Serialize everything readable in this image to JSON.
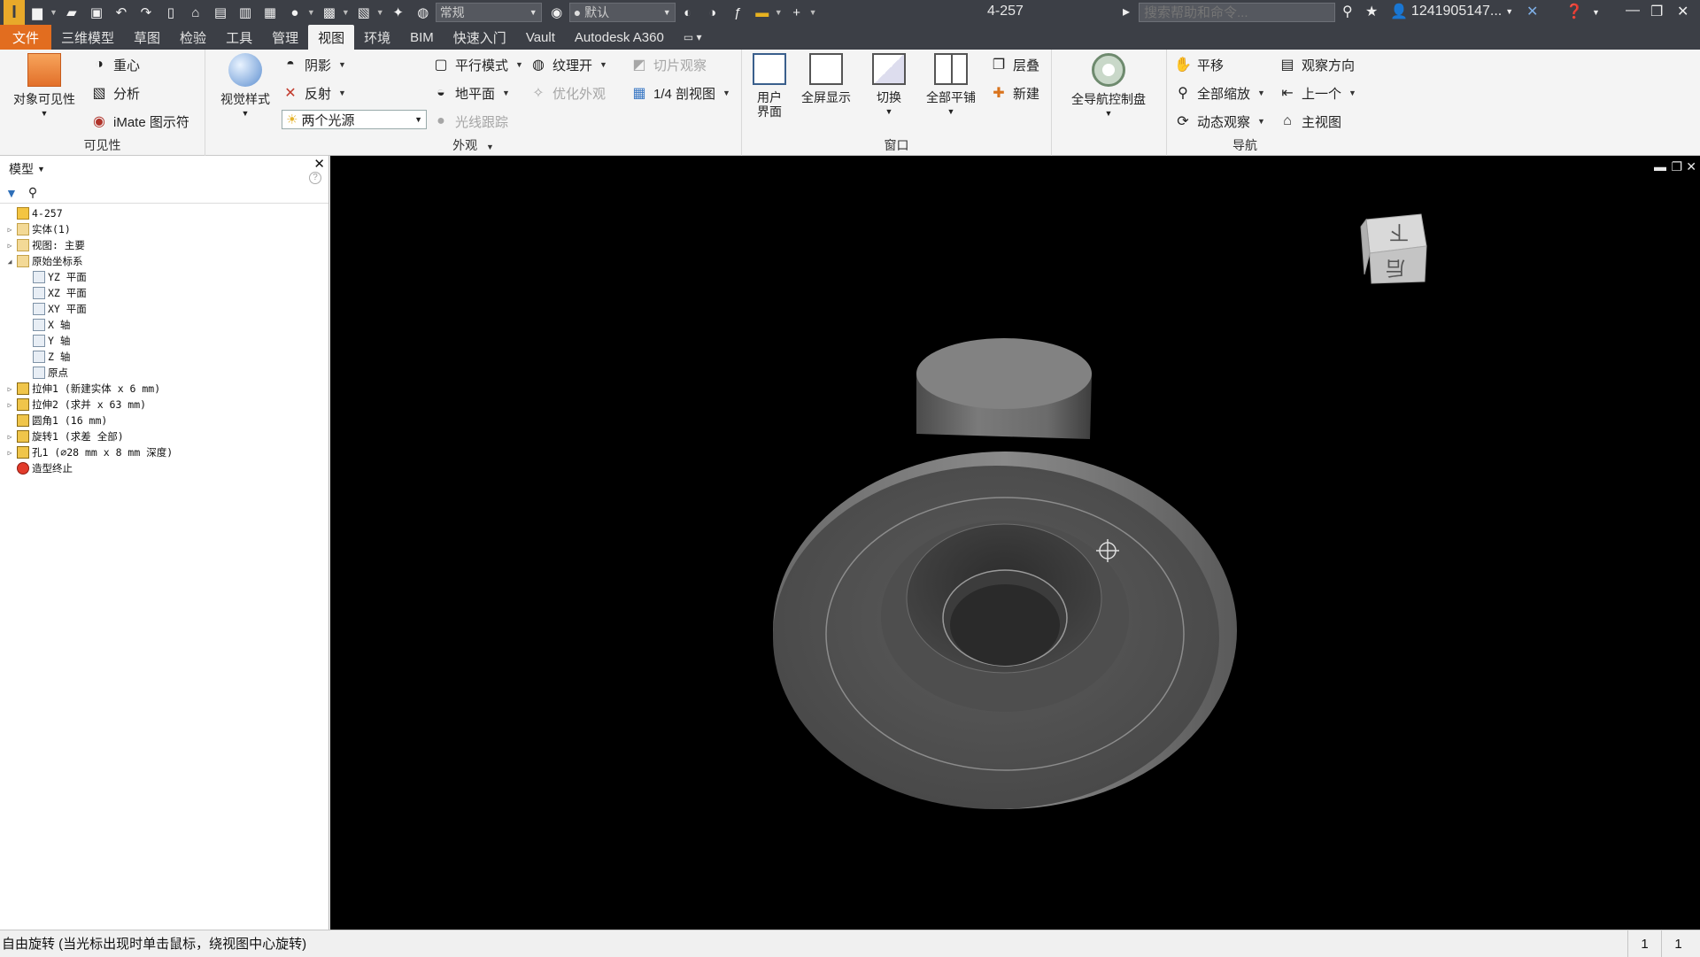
{
  "window": {
    "doc_title": "4-257",
    "search_placeholder": "搜索帮助和命令...",
    "user": "1241905147...",
    "appearance_combo": "常规",
    "material_combo": "默认"
  },
  "tabs": [
    {
      "label": "文件"
    },
    {
      "label": "三维模型"
    },
    {
      "label": "草图"
    },
    {
      "label": "检验"
    },
    {
      "label": "工具"
    },
    {
      "label": "管理"
    },
    {
      "label": "视图"
    },
    {
      "label": "环境"
    },
    {
      "label": "BIM"
    },
    {
      "label": "快速入门"
    },
    {
      "label": "Vault"
    },
    {
      "label": "Autodesk A360"
    }
  ],
  "ribbon": {
    "visibility": {
      "title": "可见性",
      "object_visibility": "对象可见性",
      "center_of_gravity": "重心",
      "analysis": "分析",
      "imate_glyph": "iMate 图示符"
    },
    "appearance": {
      "title": "外观",
      "visual_style": "视觉样式",
      "shadows": "阴影",
      "reflections": "反射",
      "lighting": "两个光源",
      "parallel_mode": "平行模式",
      "ground_plane": "地平面",
      "texture_on": "纹理开",
      "optimize_appearance": "优化外观",
      "ray_tracing": "光线跟踪",
      "slice_graphics": "切片观察",
      "quarter_section": "1/4 剖视图"
    },
    "windows": {
      "title": "窗口",
      "user_interface_1": "用户",
      "user_interface_2": "界面",
      "full_screen": "全屏显示",
      "switch": "切换",
      "tile_all": "全部平铺",
      "cascade": "层叠",
      "new": "新建"
    },
    "steering": {
      "full_navigation_wheel": "全导航控制盘"
    },
    "navigate": {
      "title": "导航",
      "pan": "平移",
      "zoom_all": "全部缩放",
      "orbit": "动态观察",
      "look_at": "观察方向",
      "previous": "上一个",
      "home_view": "主视图"
    }
  },
  "browser": {
    "title": "模型",
    "tree": [
      {
        "label": "4-257",
        "icon": "part-icon",
        "indent": 0,
        "expander": ""
      },
      {
        "label": "实体(1)",
        "icon": "folder-icon",
        "indent": 0,
        "expander": "▷"
      },
      {
        "label": "视图: 主要",
        "icon": "view-icon",
        "indent": 0,
        "expander": "▷"
      },
      {
        "label": "原始坐标系",
        "icon": "folder-icon",
        "indent": 0,
        "expander": "◢"
      },
      {
        "label": "YZ 平面",
        "icon": "plane-icon",
        "indent": 1,
        "expander": ""
      },
      {
        "label": "XZ 平面",
        "icon": "plane-icon",
        "indent": 1,
        "expander": ""
      },
      {
        "label": "XY 平面",
        "icon": "plane-icon",
        "indent": 1,
        "expander": ""
      },
      {
        "label": "X 轴",
        "icon": "axis-icon",
        "indent": 1,
        "expander": ""
      },
      {
        "label": "Y 轴",
        "icon": "axis-icon",
        "indent": 1,
        "expander": ""
      },
      {
        "label": "Z 轴",
        "icon": "axis-icon",
        "indent": 1,
        "expander": ""
      },
      {
        "label": "原点",
        "icon": "point-icon",
        "indent": 1,
        "expander": ""
      },
      {
        "label": "拉伸1 (新建实体 x 6 mm)",
        "icon": "extrude-icon",
        "indent": 0,
        "expander": "▷"
      },
      {
        "label": "拉伸2 (求并 x 63 mm)",
        "icon": "extrude-icon",
        "indent": 0,
        "expander": "▷"
      },
      {
        "label": "圆角1 (16 mm)",
        "icon": "fillet-icon",
        "indent": 0,
        "expander": ""
      },
      {
        "label": "旋转1 (求差 全部)",
        "icon": "revolve-icon",
        "indent": 0,
        "expander": "▷"
      },
      {
        "label": "孔1 (⌀28 mm x 8 mm 深度)",
        "icon": "hole-icon",
        "indent": 0,
        "expander": "▷"
      },
      {
        "label": "造型终止",
        "icon": "end-of-part-icon",
        "indent": 0,
        "expander": ""
      }
    ]
  },
  "viewcube": {
    "face_top": "下",
    "face_front": "后"
  },
  "status": {
    "message": "自由旋转 (当光标出现时单击鼠标，绕视图中心旋转)",
    "cell_1": "1",
    "cell_2": "1"
  },
  "colors": {
    "title_bg": "#3c3f46",
    "file_tab": "#e26d1f",
    "viewport_bg": "#000000",
    "part_gray": "#5e5e5e"
  }
}
